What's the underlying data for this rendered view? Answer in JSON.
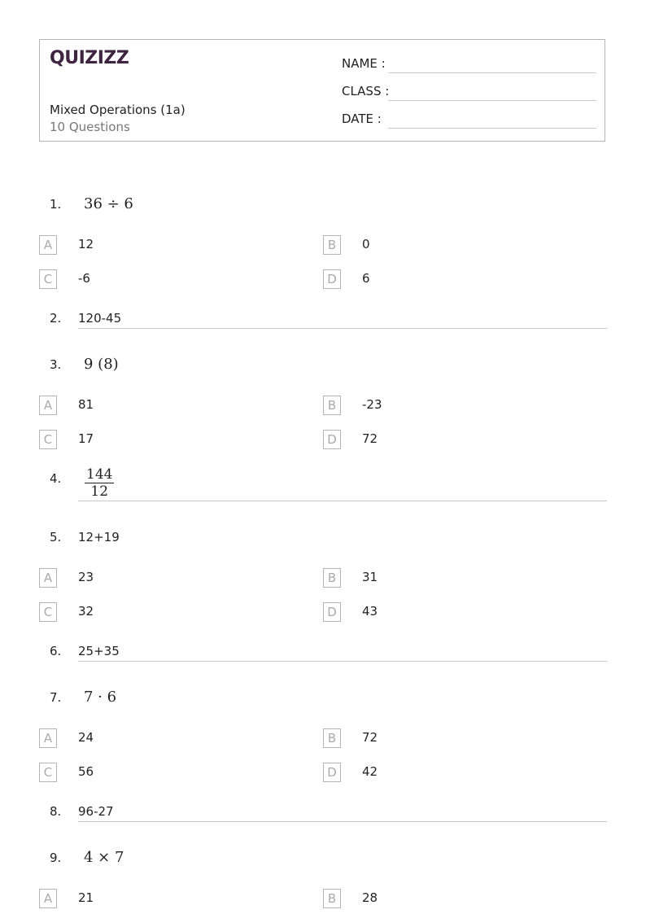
{
  "header": {
    "logo": "QUIZIZZ",
    "title": "Mixed Operations (1a)",
    "subtitle": "10 Questions",
    "fields": [
      {
        "label": "NAME :"
      },
      {
        "label": "CLASS :"
      },
      {
        "label": "DATE  :"
      }
    ]
  },
  "questions": [
    {
      "number": "1.",
      "text": "36 ÷ 6",
      "options": [
        {
          "letter": "A",
          "value": "12"
        },
        {
          "letter": "B",
          "value": "0"
        },
        {
          "letter": "C",
          "value": "-6"
        },
        {
          "letter": "D",
          "value": "6"
        }
      ]
    },
    {
      "number": "2.",
      "text": "120-45"
    },
    {
      "number": "3.",
      "text": "9 (8)",
      "options": [
        {
          "letter": "A",
          "value": "81"
        },
        {
          "letter": "B",
          "value": "-23"
        },
        {
          "letter": "C",
          "value": "17"
        },
        {
          "letter": "D",
          "value": "72"
        }
      ]
    },
    {
      "number": "4.",
      "numerator": "144",
      "denominator": "12"
    },
    {
      "number": "5.",
      "text": "12+19",
      "options": [
        {
          "letter": "A",
          "value": "23"
        },
        {
          "letter": "B",
          "value": "31"
        },
        {
          "letter": "C",
          "value": "32"
        },
        {
          "letter": "D",
          "value": "43"
        }
      ]
    },
    {
      "number": "6.",
      "text": "25+35"
    },
    {
      "number": "7.",
      "text": "7 · 6",
      "options": [
        {
          "letter": "A",
          "value": "24"
        },
        {
          "letter": "B",
          "value": "72"
        },
        {
          "letter": "C",
          "value": "56"
        },
        {
          "letter": "D",
          "value": "42"
        }
      ]
    },
    {
      "number": "8.",
      "text": "96-27"
    },
    {
      "number": "9.",
      "text": "4 × 7",
      "options": [
        {
          "letter": "A",
          "value": "21"
        },
        {
          "letter": "B",
          "value": "28"
        }
      ]
    }
  ]
}
